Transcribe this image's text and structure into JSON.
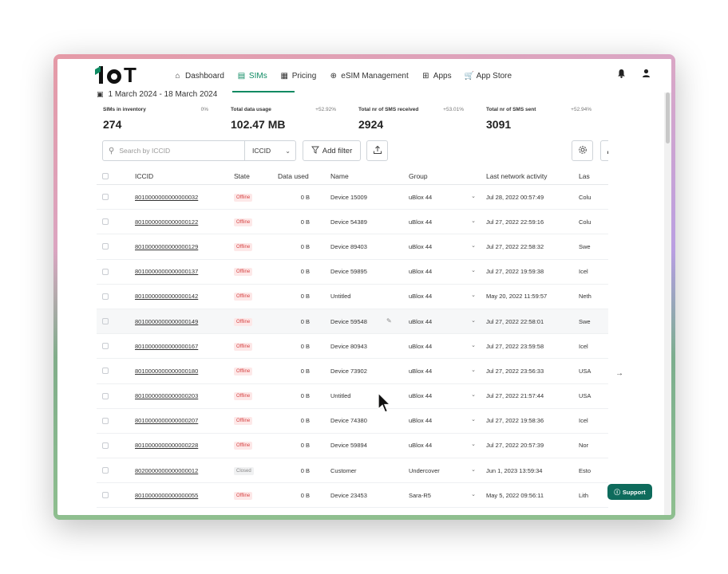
{
  "nav": {
    "logo_text": "IoT",
    "items": [
      {
        "label": "Dashboard",
        "icon": "home-icon",
        "glyph": "⌂"
      },
      {
        "label": "SIMs",
        "icon": "sim-icon",
        "glyph": "▤"
      },
      {
        "label": "Pricing",
        "icon": "pricing-icon",
        "glyph": "▦"
      },
      {
        "label": "eSIM Management",
        "icon": "globe-icon",
        "glyph": "⊕"
      },
      {
        "label": "Apps",
        "icon": "apps-grid-icon",
        "glyph": "⊞"
      },
      {
        "label": "App Store",
        "icon": "cart-icon",
        "glyph": "🛒"
      }
    ],
    "active": "SIMs"
  },
  "date_range": "1 March 2024 - 18 March 2024",
  "stats": [
    {
      "label": "SIMs in inventory",
      "change": "0%",
      "value": "274"
    },
    {
      "label": "Total data usage",
      "change": "+52.92%",
      "value": "102.47 MB"
    },
    {
      "label": "Total nr of SMS received",
      "change": "+53.01%",
      "value": "2924"
    },
    {
      "label": "Total nr of SMS sent",
      "change": "+52.94%",
      "value": "3091"
    }
  ],
  "toolbar": {
    "search_placeholder": "Search by ICCID",
    "search_field": "ICCID",
    "add_filter": "Add filter"
  },
  "table": {
    "columns": [
      "ICCID",
      "State",
      "Data used",
      "Name",
      "Group",
      "Last network activity",
      "Las"
    ],
    "rows": [
      {
        "iccid": "8010000000000000032",
        "state": "Offline",
        "data": "0 B",
        "name": "Device 15009",
        "group": "uBlox 44",
        "activity": "Jul 28, 2022 00:57:49",
        "last": "Colu"
      },
      {
        "iccid": "8010000000000000122",
        "state": "Offline",
        "data": "0 B",
        "name": "Device 54389",
        "group": "uBlox 44",
        "activity": "Jul 27, 2022 22:59:16",
        "last": "Colu"
      },
      {
        "iccid": "8010000000000000129",
        "state": "Offline",
        "data": "0 B",
        "name": "Device 89403",
        "group": "uBlox 44",
        "activity": "Jul 27, 2022 22:58:32",
        "last": "Swe"
      },
      {
        "iccid": "8010000000000000137",
        "state": "Offline",
        "data": "0 B",
        "name": "Device 59895",
        "group": "uBlox 44",
        "activity": "Jul 27, 2022 19:59:38",
        "last": "Icel"
      },
      {
        "iccid": "8010000000000000142",
        "state": "Offline",
        "data": "0 B",
        "name": "Untitled",
        "group": "uBlox 44",
        "activity": "May 20, 2022 11:59:57",
        "last": "Neth"
      },
      {
        "iccid": "8010000000000000149",
        "state": "Offline",
        "data": "0 B",
        "name": "Device 59548",
        "group": "uBlox 44",
        "activity": "Jul 27, 2022 22:58:01",
        "last": "Swe"
      },
      {
        "iccid": "8010000000000000167",
        "state": "Offline",
        "data": "0 B",
        "name": "Device 80943",
        "group": "uBlox 44",
        "activity": "Jul 27, 2022 23:59:58",
        "last": "Icel"
      },
      {
        "iccid": "8010000000000000180",
        "state": "Offline",
        "data": "0 B",
        "name": "Device 73902",
        "group": "uBlox 44",
        "activity": "Jul 27, 2022 23:56:33",
        "last": "USA"
      },
      {
        "iccid": "8010000000000000203",
        "state": "Offline",
        "data": "0 B",
        "name": "Untitled",
        "group": "uBlox 44",
        "activity": "Jul 27, 2022 21:57:44",
        "last": "USA"
      },
      {
        "iccid": "8010000000000000207",
        "state": "Offline",
        "data": "0 B",
        "name": "Device 74380",
        "group": "uBlox 44",
        "activity": "Jul 27, 2022 19:58:36",
        "last": "Icel"
      },
      {
        "iccid": "8010000000000000228",
        "state": "Offline",
        "data": "0 B",
        "name": "Device 59894",
        "group": "uBlox 44",
        "activity": "Jul 27, 2022 20:57:39",
        "last": "Nor"
      },
      {
        "iccid": "8020000000000000012",
        "state": "Closed",
        "data": "0 B",
        "name": "Customer",
        "group": "Undercover",
        "activity": "Jun 1, 2023 13:59:34",
        "last": "Esto"
      },
      {
        "iccid": "8010000000000000055",
        "state": "Offline",
        "data": "0 B",
        "name": "Device 23453",
        "group": "Sara-R5",
        "activity": "May 5, 2022 09:56:11",
        "last": "Lith"
      }
    ]
  },
  "support_label": "Support",
  "colors": {
    "brand": "#0e8a62",
    "support": "#0e6b5c",
    "offline_bg": "#fde8e8",
    "offline_text": "#d64545"
  }
}
